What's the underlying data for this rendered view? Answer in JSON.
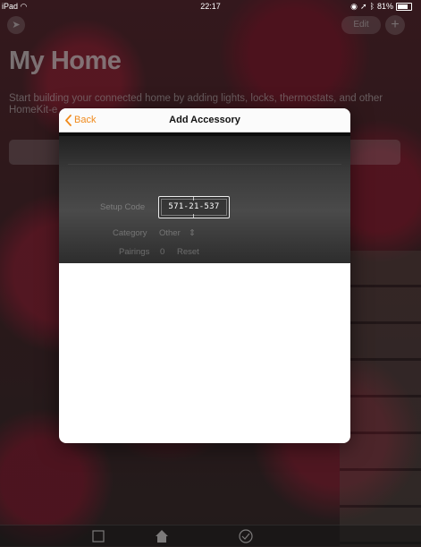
{
  "status_bar": {
    "device": "iPad",
    "time": "22:17",
    "battery": "81%"
  },
  "background": {
    "title": "My Home",
    "description": "Start building your connected home by adding lights, locks, thermostats, and other HomeKit-e",
    "edit_label": "Edit",
    "add_label": "+"
  },
  "modal": {
    "back_label": "Back",
    "title": "Add Accessory",
    "setup_code_label": "Setup Code",
    "setup_code": "571-21-537",
    "category_label": "Category",
    "category_value": "Other",
    "pairings_label": "Pairings",
    "pairings_value": "0",
    "reset_label": "Reset"
  },
  "colors": {
    "accent": "#f08a1c",
    "modal_bg": "#ffffff",
    "camera_bg": "#3a3a3a"
  }
}
